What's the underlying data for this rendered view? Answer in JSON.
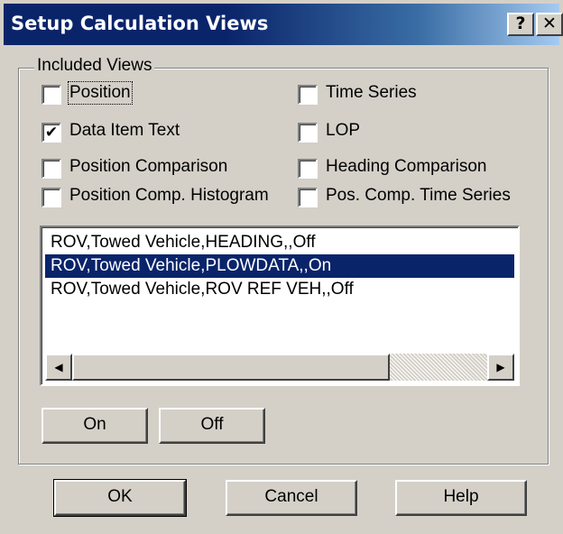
{
  "window": {
    "title": "Setup Calculation Views",
    "help_button": "?",
    "close_button": "✕"
  },
  "group": {
    "label": "Included Views",
    "checkboxes": [
      {
        "label": "Position",
        "checked": false,
        "mark": ""
      },
      {
        "label": "Time Series",
        "checked": false,
        "mark": ""
      },
      {
        "label": "Data Item Text",
        "checked": true,
        "mark": "✔"
      },
      {
        "label": "LOP",
        "checked": false,
        "mark": ""
      },
      {
        "label": "Position Comparison",
        "checked": false,
        "mark": ""
      },
      {
        "label": "Heading Comparison",
        "checked": false,
        "mark": ""
      },
      {
        "label": "Position Comp. Histogram",
        "checked": false,
        "mark": ""
      },
      {
        "label": "Pos. Comp. Time Series",
        "checked": false,
        "mark": ""
      }
    ]
  },
  "list": {
    "items": [
      {
        "text": "ROV,Towed Vehicle,HEADING,,Off",
        "selected": false
      },
      {
        "text": "ROV,Towed Vehicle,PLOWDATA,,On",
        "selected": true
      },
      {
        "text": "ROV,Towed Vehicle,ROV REF VEH,,Off",
        "selected": false
      }
    ],
    "scroll_left": "◀",
    "scroll_right": "▶"
  },
  "buttons": {
    "on": "On",
    "off": "Off",
    "ok": "OK",
    "cancel": "Cancel",
    "help": "Help"
  },
  "colors": {
    "face": "#d4d0c8",
    "title_active": "#0a246a",
    "selection": "#0a246a"
  }
}
